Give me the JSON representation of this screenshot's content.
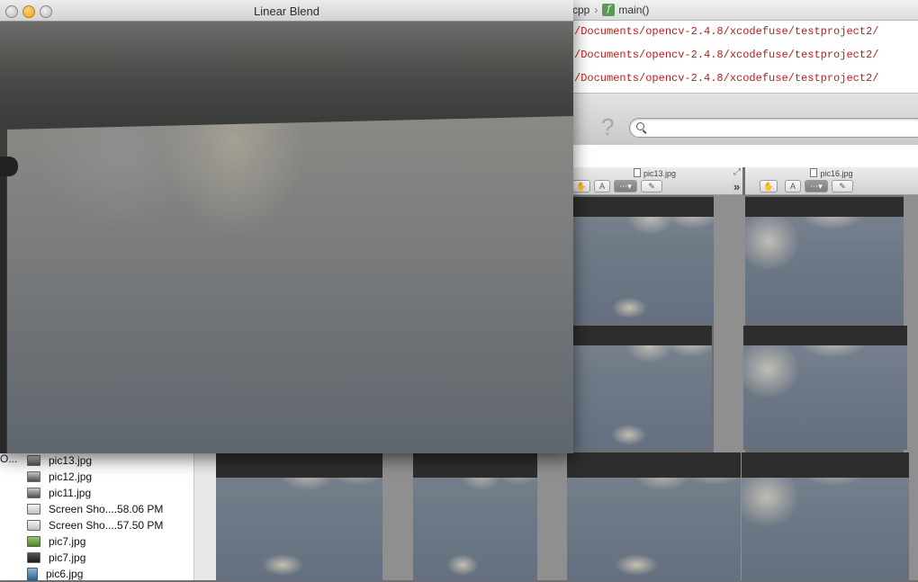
{
  "xcode": {
    "jumpbar": {
      "file_crumb": "cpp",
      "function_icon": "f",
      "function_name": "main()"
    },
    "console_lines": [
      "/Documents/opencv-2.4.8/xcodefuse/testproject2/",
      "/Documents/opencv-2.4.8/xcodefuse/testproject2/",
      "/Documents/opencv-2.4.8/xcodefuse/testproject2/"
    ],
    "help_glyph": "?",
    "search": {
      "placeholder": ""
    }
  },
  "viewers": [
    {
      "title": "pic13.jpg"
    },
    {
      "title": "pic16.jpg"
    }
  ],
  "viewer_overflow": "»",
  "blend_window": {
    "title": "Linear Blend"
  },
  "finder": {
    "truncated_label": "O...",
    "files": [
      {
        "name": "pic13.jpg",
        "icon": "image-icon"
      },
      {
        "name": "pic12.jpg",
        "icon": "image-icon"
      },
      {
        "name": "pic11.jpg",
        "icon": "image-icon"
      },
      {
        "name": "Screen Sho....58.06 PM",
        "icon": "screenshot-icon"
      },
      {
        "name": "Screen Sho....57.50 PM",
        "icon": "screenshot-icon"
      },
      {
        "name": "pic7.jpg",
        "icon": "image-preview-icon"
      },
      {
        "name": "pic7.jpg",
        "icon": "image-icon"
      },
      {
        "name": "pic6.jpg",
        "icon": "image-preview-icon"
      }
    ]
  },
  "colors": {
    "console_text": "#c41a16",
    "function_badge": "#5a9a52",
    "min_button": "#e8a31e"
  }
}
